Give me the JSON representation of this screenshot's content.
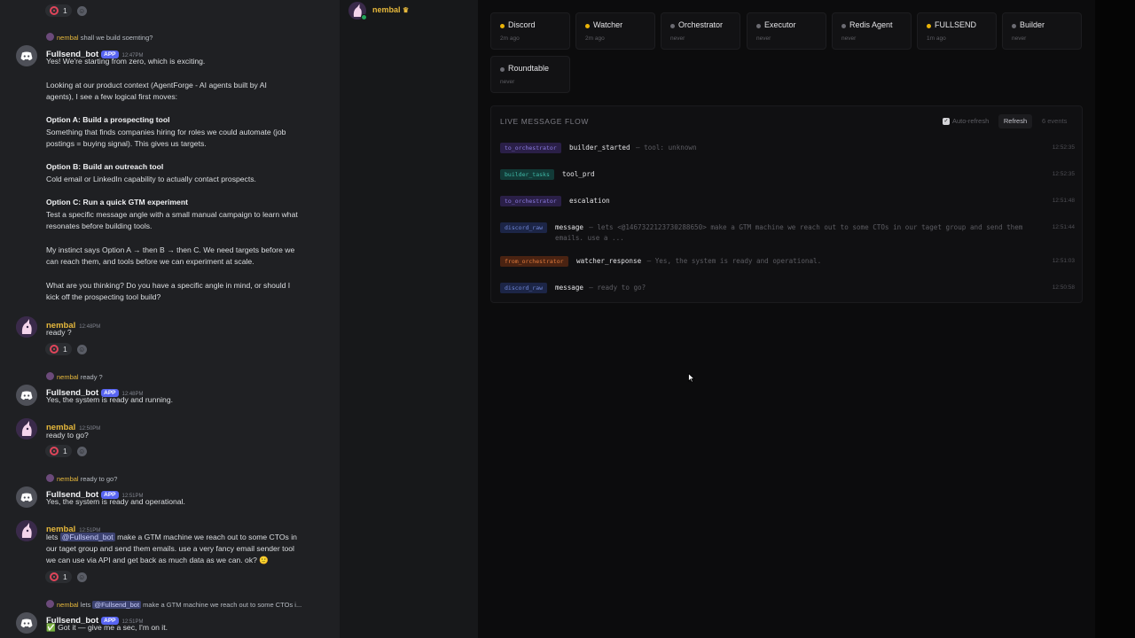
{
  "chat": {
    "top_reaction_count": "1",
    "m1": {
      "reply_user": "nembal",
      "reply_text": "shall we build soemting?",
      "user": "Fullsend_bot",
      "app": "APP",
      "time": "12:47PM",
      "l1": "Yes! We're starting from zero, which is exciting.",
      "l2": "Looking at our product context (AgentForge - AI agents built by AI",
      "l3": "agents), I see a few logical first moves:",
      "oa_title": "Option A: Build a prospecting tool",
      "oa1": "Something that finds companies hiring for roles we could automate (job",
      "oa2": "postings = buying signal). This gives us targets.",
      "ob_title": "Option B: Build an outreach tool",
      "ob1": "Cold email or LinkedIn capability to actually contact prospects.",
      "oc_title": "Option C: Run a quick GTM experiment",
      "oc1": "Test a specific message angle with a small manual campaign to learn what",
      "oc2": "resonates before building tools.",
      "i1": "My instinct says Option A → then B → then C. We need targets before we",
      "i2": "can reach them, and tools before we can experiment at scale.",
      "q1": "What are you thinking? Do you have a specific angle in mind, or should I",
      "q2": "kick off the prospecting tool build?"
    },
    "m2": {
      "user": "nembal",
      "time": "12:48PM",
      "text": "ready ?",
      "count": "1"
    },
    "m3": {
      "reply_user": "nembal",
      "reply_text": "ready ?",
      "user": "Fullsend_bot",
      "app": "APP",
      "time": "12:48PM",
      "text": "Yes, the system is ready and running."
    },
    "m4": {
      "user": "nembal",
      "time": "12:50PM",
      "text": "ready to go?",
      "count": "1"
    },
    "m5": {
      "reply_user": "nembal",
      "reply_text": "ready to go?",
      "user": "Fullsend_bot",
      "app": "APP",
      "time": "12:51PM",
      "text": "Yes, the system is ready and operational."
    },
    "m6": {
      "user": "nembal",
      "time": "12:51PM",
      "pre": "lets ",
      "mention": "@Fullsend_bot",
      "post": " make a GTM machine we reach out to some CTOs in",
      "l2": "our taget group and send them emails. use a very fancy email sender tool",
      "l3": "we can use via API and get back as much data as we can. ok? 🙂",
      "count": "1"
    },
    "m7": {
      "reply_user": "nembal",
      "reply_pre": "lets ",
      "reply_mention": "@Fullsend_bot",
      "reply_post": " make a GTM machine we reach out to some CTOs i...",
      "user": "Fullsend_bot",
      "app": "APP",
      "time": "12:51PM",
      "text": "✅ Got it — give me a sec, I'm on it."
    }
  },
  "member": {
    "name": "nembal",
    "crown": "♛"
  },
  "agents": [
    {
      "name": "Discord",
      "sub": "2m ago",
      "color": "#eab308"
    },
    {
      "name": "Watcher",
      "sub": "2m ago",
      "color": "#eab308"
    },
    {
      "name": "Orchestrator",
      "sub": "never",
      "color": "#6b6b72"
    },
    {
      "name": "Executor",
      "sub": "never",
      "color": "#6b6b72"
    },
    {
      "name": "Redis Agent",
      "sub": "never",
      "color": "#6b6b72"
    },
    {
      "name": "FULLSEND",
      "sub": "1m ago",
      "color": "#eab308"
    },
    {
      "name": "Builder",
      "sub": "never",
      "color": "#6b6b72"
    },
    {
      "name": "Roundtable",
      "sub": "never",
      "color": "#6b6b72"
    }
  ],
  "flow": {
    "title": "LIVE MESSAGE FLOW",
    "auto_refresh": "Auto-refresh",
    "refresh": "Refresh",
    "count": "6 events",
    "events": [
      {
        "channel": "to_orchestrator",
        "type": "builder_started",
        "text": "— tool: unknown",
        "time": "12:52:35",
        "chip_bg": "#2a1f47",
        "chip_fg": "#8b7be0"
      },
      {
        "channel": "builder_tasks",
        "type": "tool_prd",
        "text": "",
        "time": "12:52:35",
        "chip_bg": "#123a37",
        "chip_fg": "#3fb8a6"
      },
      {
        "channel": "to_orchestrator",
        "type": "escalation",
        "text": "",
        "time": "12:51:48",
        "chip_bg": "#2a1f47",
        "chip_fg": "#8b7be0"
      },
      {
        "channel": "discord_raw",
        "type": "message",
        "text": "— lets <@1467322123730288650> make a GTM machine we reach out to some CTOs in our taget group and send them",
        "text2": "emails. use a ...",
        "time": "12:51:44",
        "chip_bg": "#1c2546",
        "chip_fg": "#6f86d6"
      },
      {
        "channel": "from_orchestrator",
        "type": "watcher_response",
        "text": "— Yes, the system is ready and operational.",
        "time": "12:51:03",
        "chip_bg": "#4a2312",
        "chip_fg": "#e07a3c"
      },
      {
        "channel": "discord_raw",
        "type": "message",
        "text": "— ready to go?",
        "time": "12:50:58",
        "chip_bg": "#1c2546",
        "chip_fg": "#6f86d6"
      }
    ]
  }
}
